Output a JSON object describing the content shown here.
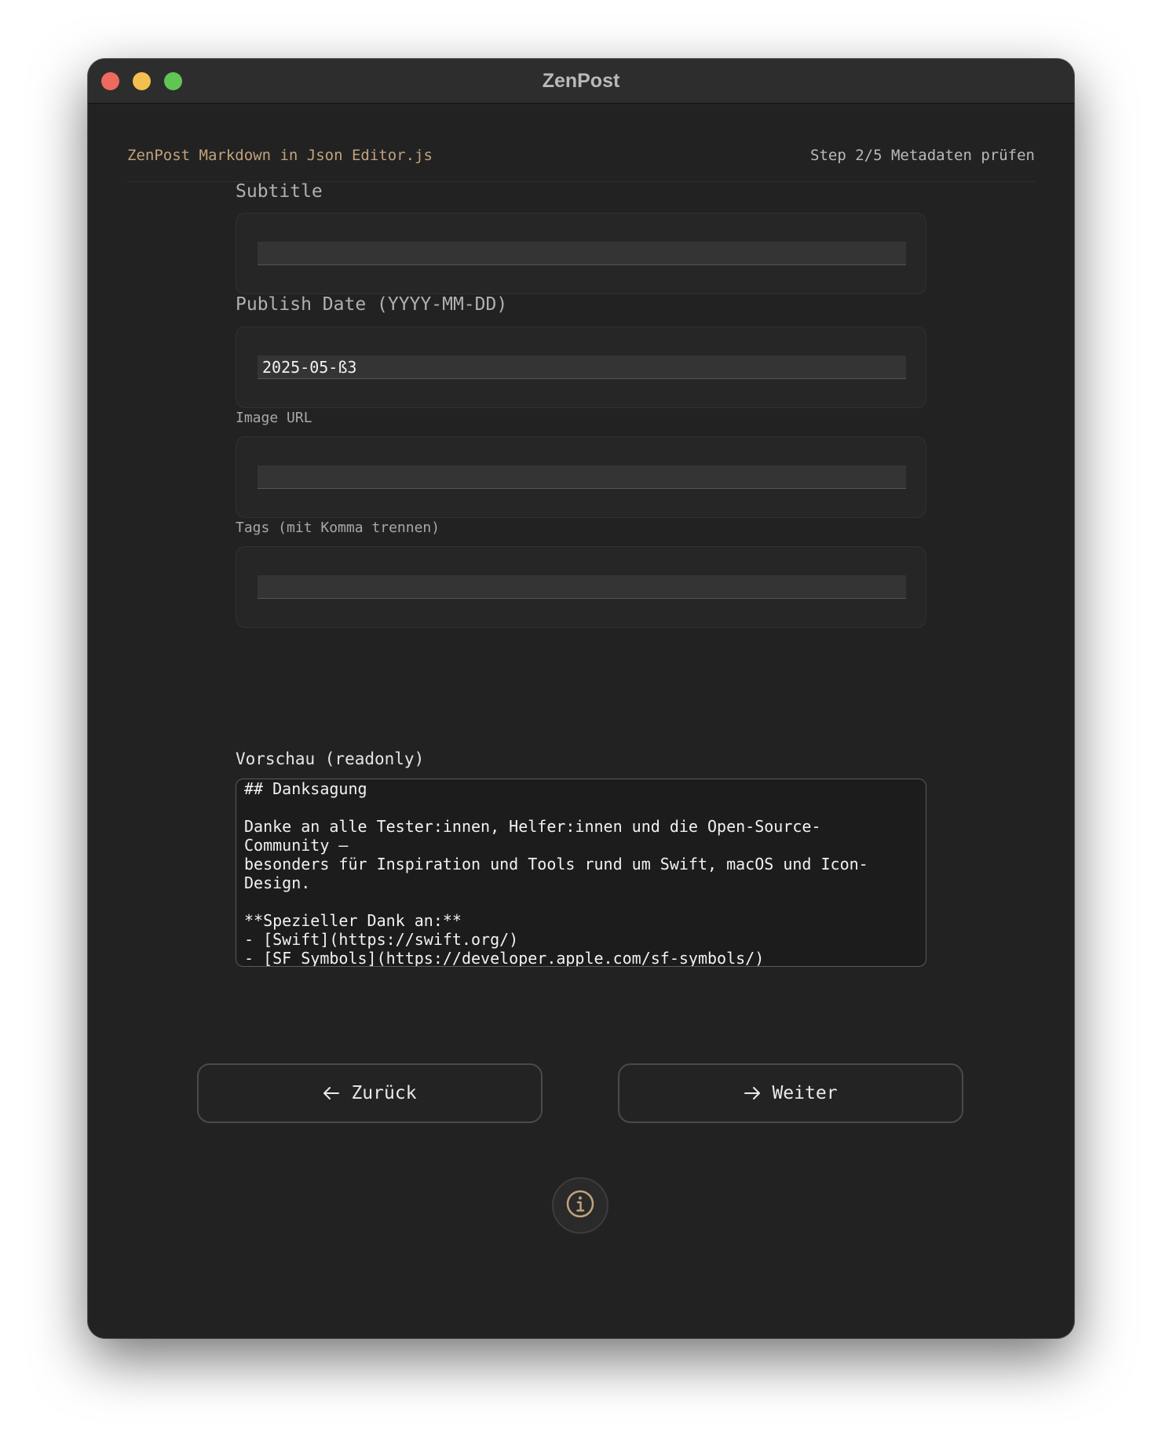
{
  "window": {
    "title": "ZenPost"
  },
  "header": {
    "app_name": "ZenPost Markdown in Json Editor.js",
    "step": "Step 2/5 Metadaten prüfen"
  },
  "fields": {
    "subtitle": {
      "label": "Subtitle",
      "value": ""
    },
    "publish_date": {
      "label": "Publish Date (YYYY-MM-DD)",
      "value": "2025-05-ß3"
    },
    "image_url": {
      "label": "Image URL",
      "value": ""
    },
    "tags": {
      "label": "Tags (mit Komma trennen)",
      "value": ""
    }
  },
  "preview": {
    "label": "Vorschau (readonly)",
    "content": "## Danksagung\n\nDanke an alle Tester:innen, Helfer:innen und die Open-Source-\nCommunity —\nbesonders für Inspiration und Tools rund um Swift, macOS und Icon-\nDesign.\n\n**Spezieller Dank an:**\n- [Swift](https://swift.org/)\n- [SF Symbols](https://developer.apple.com/sf-symbols/)"
  },
  "nav": {
    "back_label": "Zurück",
    "next_label": "Weiter"
  },
  "colors": {
    "accent": "#c2a27c",
    "window_bg": "#222222",
    "close": "#ed6a5e",
    "minimize": "#f5bf4f",
    "maximize": "#61c554"
  },
  "icons": {
    "back": "arrow-left-icon",
    "next": "arrow-right-icon",
    "info": "info-circle-icon"
  }
}
